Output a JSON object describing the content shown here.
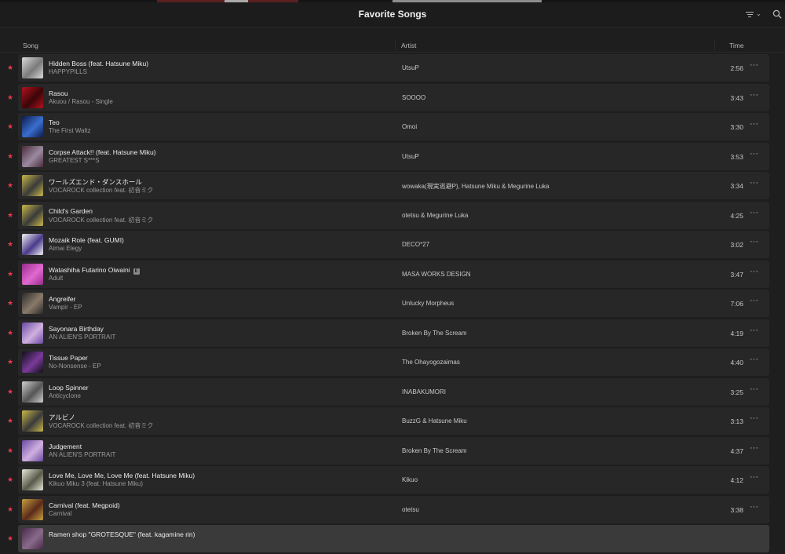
{
  "window": {
    "title": "Favorite Songs"
  },
  "toolbar": {
    "sort_icon": "sort-lines-icon",
    "sort_chevron": "⌄",
    "search_icon": "search-icon"
  },
  "columns": {
    "song": "Song",
    "artist": "Artist",
    "time": "Time"
  },
  "colors": {
    "star": "#e33a4f",
    "row": "#272727",
    "background": "#1e1e1e"
  },
  "songs": [
    {
      "title": "Hidden Boss (feat. Hatsune Miku)",
      "album": "HAPPYPILLS",
      "artist": "UtsuP",
      "time": "2:56",
      "art": [
        "#d9d9d9",
        "#7a7a7a"
      ]
    },
    {
      "title": "Rasou",
      "album": "Akuou / Rasou - Single",
      "artist": "SOOOO",
      "time": "3:43",
      "art": [
        "#b3121e",
        "#3a0508"
      ]
    },
    {
      "title": "Teo",
      "album": "The First Waltz",
      "artist": "Omoi",
      "time": "3:30",
      "art": [
        "#0e1a4a",
        "#3a6fd0"
      ]
    },
    {
      "title": "Corpse Attack!! (feat. Hatsune Miku)",
      "album": "GREATEST S***S",
      "artist": "UtsuP",
      "time": "3:53",
      "art": [
        "#4a2a3a",
        "#9a8aa0"
      ]
    },
    {
      "title": "ワールズエンド・ダンスホール",
      "album": "VOCAROCK collection feat. 初音ミク",
      "artist": "wowaka(現実逃避P), Hatsune Miku & Megurine Luka",
      "time": "3:34",
      "art": [
        "#c9b84a",
        "#3a3a3a"
      ]
    },
    {
      "title": "Child's Garden",
      "album": "VOCAROCK collection feat. 初音ミク",
      "artist": "otetsu & Megurine Luka",
      "time": "4:25",
      "art": [
        "#c9b84a",
        "#3a3a3a"
      ]
    },
    {
      "title": "Mozaik Role (feat. GUMI)",
      "album": "Aimai Elegy",
      "artist": "DECO*27",
      "time": "3:02",
      "art": [
        "#f2f2f2",
        "#4a3a8a"
      ]
    },
    {
      "title": "Watashiha Futarino Oiwaini",
      "album": "Adult",
      "artist": "MASA WORKS DESIGN",
      "time": "3:47",
      "art": [
        "#9a2a8a",
        "#e06ad0"
      ],
      "explicit": "E"
    },
    {
      "title": "Angreifer",
      "album": "Vampir - EP",
      "artist": "Unlucky Morpheus",
      "time": "7:06",
      "art": [
        "#2a2a2a",
        "#8a7a6a"
      ]
    },
    {
      "title": "Sayonara Birthday",
      "album": "AN ALIEN'S PORTRAIT",
      "artist": "Broken By The Scream",
      "time": "4:19",
      "art": [
        "#6a4aa0",
        "#d0b0e0"
      ]
    },
    {
      "title": "Tissue Paper",
      "album": "No-Nonsense - EP",
      "artist": "The Ohayogozaimas",
      "time": "4:40",
      "art": [
        "#101018",
        "#7a3a9a"
      ]
    },
    {
      "title": "Loop Spinner",
      "album": "Anticyclone",
      "artist": "INABAKUMORI",
      "time": "3:25",
      "art": [
        "#cfcfcf",
        "#555555"
      ]
    },
    {
      "title": "アルビノ",
      "album": "VOCAROCK collection feat. 初音ミク",
      "artist": "BuzzG & Hatsune Miku",
      "time": "3:13",
      "art": [
        "#c9b84a",
        "#3a3a3a"
      ]
    },
    {
      "title": "Judgement",
      "album": "AN ALIEN'S PORTRAIT",
      "artist": "Broken By The Scream",
      "time": "4:37",
      "art": [
        "#6a4aa0",
        "#d0b0e0"
      ]
    },
    {
      "title": "Love Me, Love Me, Love Me (feat. Hatsune Miku)",
      "album": "Kikuo Miku 3 (feat. Hatsune Miku)",
      "artist": "Kikuo",
      "time": "4:12",
      "art": [
        "#e8e8d8",
        "#5a5a4a"
      ]
    },
    {
      "title": "Carnival (feat. Megpoid)",
      "album": "Carnival",
      "artist": "otetsu",
      "time": "3:38",
      "art": [
        "#c8a040",
        "#5a2a1a"
      ]
    },
    {
      "title": "Ramen shop \"GROTESQUE\" (feat. kagamine rin)",
      "album": "",
      "artist": "",
      "time": "",
      "art": [
        "#4a2a4a",
        "#8a6a8a"
      ]
    }
  ]
}
